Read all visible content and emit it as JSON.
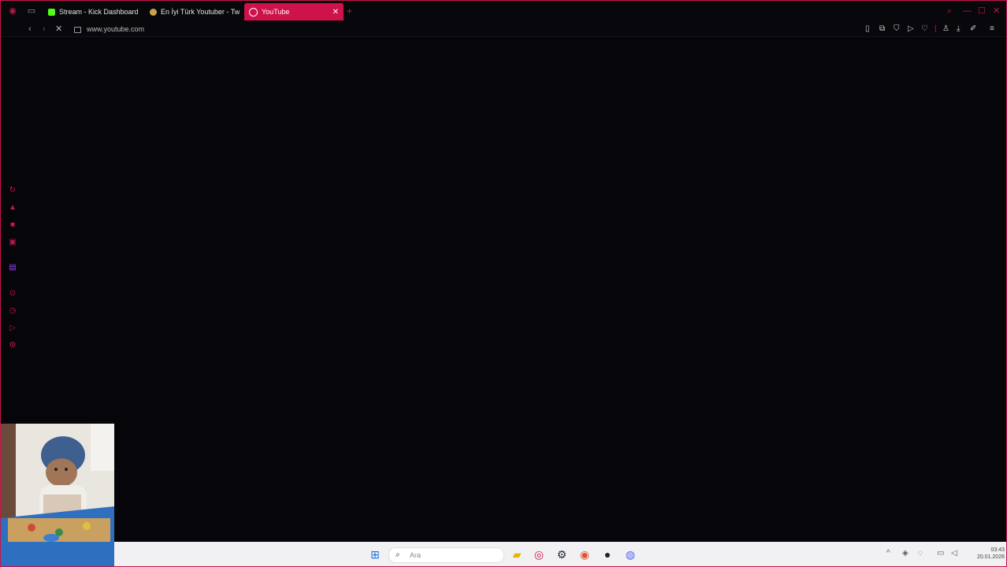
{
  "browser": {
    "tabs": [
      {
        "label": "Stream - Kick Dashboard",
        "favicon": "kick-icon",
        "color": "#53fc18",
        "active": false
      },
      {
        "label": "En İyi Türk Youtuber - Tw",
        "favicon": "tweet-icon",
        "color": "#c9a44a",
        "active": false
      },
      {
        "label": "YouTube",
        "favicon": "youtube-icon",
        "color": "#ffffff",
        "active": true
      }
    ],
    "url": "www.youtube.com",
    "accent": "#c8144a"
  },
  "taskbar": {
    "search_placeholder": "Ara",
    "clock_time": "03:43",
    "clock_date": "20.01.2026"
  }
}
